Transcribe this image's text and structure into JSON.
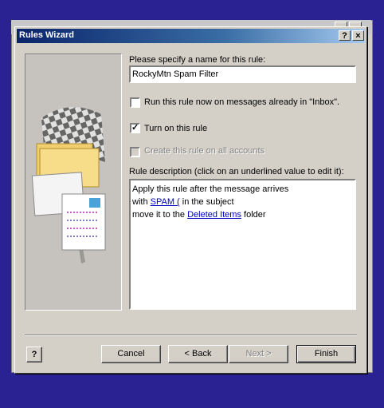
{
  "background_window": {
    "title": "Rules Wizard",
    "buttons": [
      "?",
      "×"
    ]
  },
  "window": {
    "title": "Rules Wizard",
    "help_button": "?",
    "close_button": "×"
  },
  "form": {
    "name_label": "Please specify a name for this rule:",
    "name_value": "RockyMtn Spam Filter",
    "run_now_label": "Run this rule now on messages already in \"Inbox\".",
    "run_now_checked": false,
    "turn_on_label": "Turn on this rule",
    "turn_on_checked": true,
    "all_accounts_label": "Create this rule on all accounts",
    "all_accounts_checked": false,
    "description_label": "Rule description (click on an underlined value to edit it):",
    "description": {
      "line1": "Apply this rule after the message arrives",
      "line2_prefix": "with ",
      "line2_link": "SPAM (",
      "line2_suffix": " in the subject",
      "line3_prefix": "move it to the ",
      "line3_link": "Deleted Items",
      "line3_suffix": " folder"
    }
  },
  "buttons": {
    "help": "?",
    "cancel": "Cancel",
    "back": "< Back",
    "next": "Next >",
    "finish": "Finish"
  }
}
